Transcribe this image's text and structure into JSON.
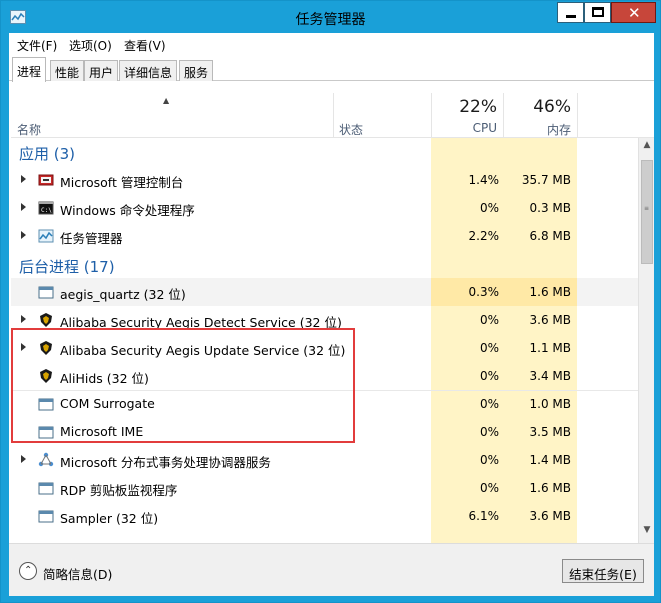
{
  "window": {
    "title": "任务管理器"
  },
  "menu": [
    "文件(F)",
    "选项(O)",
    "查看(V)"
  ],
  "tabs": [
    "进程",
    "性能",
    "用户",
    "详细信息",
    "服务"
  ],
  "header": {
    "name": "名称",
    "status": "状态",
    "cpu_pct": "22%",
    "cpu": "CPU",
    "mem_pct": "46%",
    "mem": "内存"
  },
  "groups": {
    "apps": "应用 (3)",
    "background": "后台进程 (17)"
  },
  "apps": [
    {
      "name": "Microsoft 管理控制台",
      "cpu": "1.4%",
      "mem": "35.7 MB",
      "icon": "mmc-icon"
    },
    {
      "name": "Windows 命令处理程序",
      "cpu": "0%",
      "mem": "0.3 MB",
      "icon": "cmd-icon"
    },
    {
      "name": "任务管理器",
      "cpu": "2.2%",
      "mem": "6.8 MB",
      "icon": "task-manager-icon"
    }
  ],
  "background": [
    {
      "name": "aegis_quartz (32 位)",
      "cpu": "0.3%",
      "mem": "1.6 MB",
      "icon": "window-icon"
    },
    {
      "name": "Alibaba Security Aegis Detect Service (32 位)",
      "cpu": "0%",
      "mem": "3.6 MB",
      "icon": "shield-bug-icon"
    },
    {
      "name": "Alibaba Security Aegis Update Service (32 位)",
      "cpu": "0%",
      "mem": "1.1 MB",
      "icon": "shield-bug-icon"
    },
    {
      "name": "AliHids (32 位)",
      "cpu": "0%",
      "mem": "3.4 MB",
      "icon": "shield-bug-icon"
    },
    {
      "name": "COM Surrogate",
      "cpu": "0%",
      "mem": "1.0 MB",
      "icon": "window-icon"
    },
    {
      "name": "Microsoft IME",
      "cpu": "0%",
      "mem": "3.5 MB",
      "icon": "window-icon"
    },
    {
      "name": "Microsoft 分布式事务处理协调器服务",
      "cpu": "0%",
      "mem": "1.4 MB",
      "icon": "network-icon"
    },
    {
      "name": "RDP 剪贴板监视程序",
      "cpu": "0%",
      "mem": "1.6 MB",
      "icon": "window-icon"
    },
    {
      "name": "Sampler (32 位)",
      "cpu": "6.1%",
      "mem": "3.6 MB",
      "icon": "window-icon"
    }
  ],
  "footer": {
    "fewer_details": "简略信息(D)",
    "end_task": "结束任务(E)"
  },
  "colors": {
    "accent": "#1aa0d8",
    "cpu_mem_highlight": "#fff4c6",
    "group_text": "#1e5fa8",
    "selection_border": "#e23c3c"
  }
}
